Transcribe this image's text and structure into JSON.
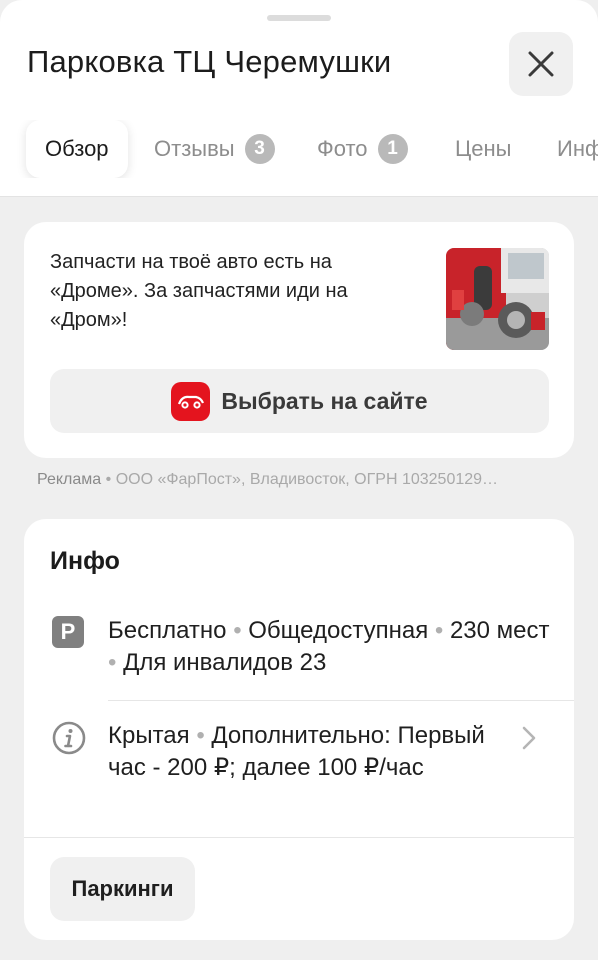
{
  "header": {
    "title": "Парковка ТЦ Черемушки"
  },
  "tabs": [
    {
      "label": "Обзор",
      "active": true
    },
    {
      "label": "Отзывы",
      "badge": "3"
    },
    {
      "label": "Фото",
      "badge": "1"
    },
    {
      "label": "Цены"
    },
    {
      "label": "Инфо"
    }
  ],
  "ad": {
    "text": "Запчасти на твоё авто есть на «Дроме». За запчастями иди на «Дром»!",
    "button_label": "Выбрать на сайте",
    "disclaimer_label": "Реклама",
    "disclaimer_text": "ООО «ФарПост», Владивосток, ОГРН 103250129…"
  },
  "info": {
    "title": "Инфо",
    "parking_icon_letter": "P",
    "row1": {
      "price": "Бесплатно",
      "access": "Общедоступная",
      "spaces": "230 мест",
      "disabled": "Для инвалидов 23"
    },
    "row2": {
      "type": "Крытая",
      "extra": "Дополнительно: Первый час - 200 ₽; далее 100 ₽/час"
    },
    "parkings_button": "Паркинги"
  },
  "colors": {
    "accent_red": "#e4141e",
    "badge_gray": "#b9b9b9",
    "background": "#efefef"
  },
  "icons": [
    "close-icon",
    "drom-logo-icon",
    "parking-icon",
    "info-icon",
    "chevron-right-icon"
  ]
}
